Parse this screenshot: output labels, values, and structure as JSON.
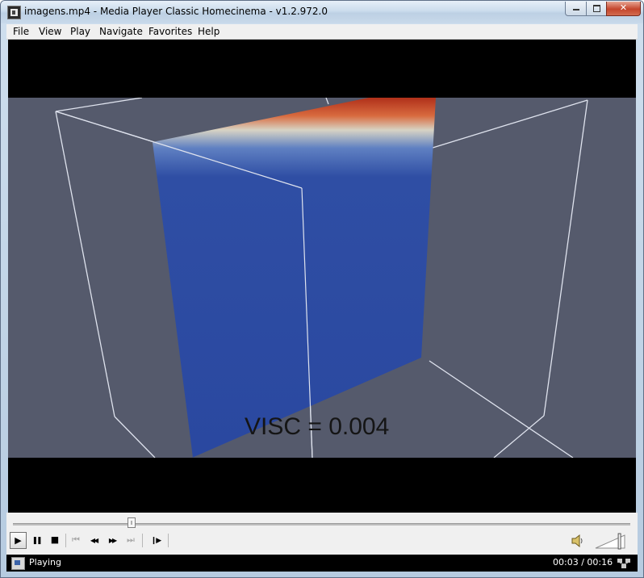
{
  "window": {
    "title": "imagens.mp4 - Media Player Classic Homecinema - v1.2.972.0",
    "icon": "media-player-icon",
    "close_glyph": "✕"
  },
  "menu": {
    "items": [
      {
        "label": "File"
      },
      {
        "label": "View"
      },
      {
        "label": "Play"
      },
      {
        "label": "Navigate"
      },
      {
        "label": "Favorites"
      },
      {
        "label": "Help"
      }
    ]
  },
  "video": {
    "overlay_text": "VISC = 0.004",
    "background_color": "#555a6c",
    "slab_color": "#2a4aa0",
    "hot_color": "#b0301a"
  },
  "seek": {
    "position_fraction": 0.1875
  },
  "controls": {
    "play": {
      "icon": "play-icon",
      "glyph": "▶"
    },
    "pause": {
      "icon": "pause-icon",
      "glyph": "❚❚"
    },
    "stop": {
      "icon": "stop-icon",
      "glyph": "■"
    },
    "prev": {
      "icon": "skip-back-icon",
      "glyph": "⏮",
      "enabled": false
    },
    "rewind": {
      "icon": "rewind-icon",
      "glyph": "◀◀"
    },
    "forward": {
      "icon": "fast-forward-icon",
      "glyph": "▶▶"
    },
    "next": {
      "icon": "skip-forward-icon",
      "glyph": "⏭",
      "enabled": false
    },
    "frame_step": {
      "icon": "frame-step-icon",
      "glyph": "❙▶"
    },
    "volume_level": 0.85
  },
  "status": {
    "state": "Playing",
    "time": "00:03 / 00:16"
  }
}
